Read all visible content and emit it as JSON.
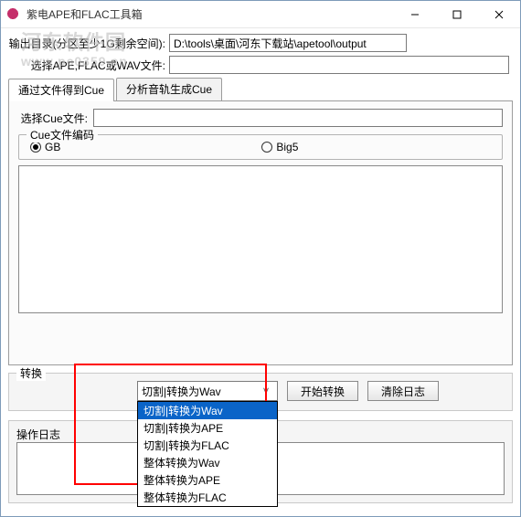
{
  "titlebar": {
    "title": "紫电APE和FLAC工具箱"
  },
  "rows": {
    "output_label": "输出目录(分区至少1G剩余空间):",
    "output_value": "D:\\tools\\桌面\\河东下载站\\apetool\\output",
    "select_file_label": "选择APE,FLAC或WAV文件:",
    "select_file_value": ""
  },
  "tabs": {
    "cue_by_file": "通过文件得到Cue",
    "cue_by_track": "分析音轨生成Cue"
  },
  "cue": {
    "select_label": "选择Cue文件:",
    "select_value": "",
    "encoding_legend": "Cue文件编码",
    "gb": "GB",
    "big5": "Big5"
  },
  "convert": {
    "title": "转换",
    "selected": "切割|转换为Wav",
    "options": [
      "切割|转换为Wav",
      "切割|转换为APE",
      "切割|转换为FLAC",
      "整体转换为Wav",
      "整体转换为APE",
      "整体转换为FLAC"
    ],
    "start": "开始转换",
    "clear": "清除日志"
  },
  "log": {
    "title": "操作日志"
  },
  "watermark": {
    "cn": "河东软件园",
    "en": "www.pc0359.cn"
  }
}
